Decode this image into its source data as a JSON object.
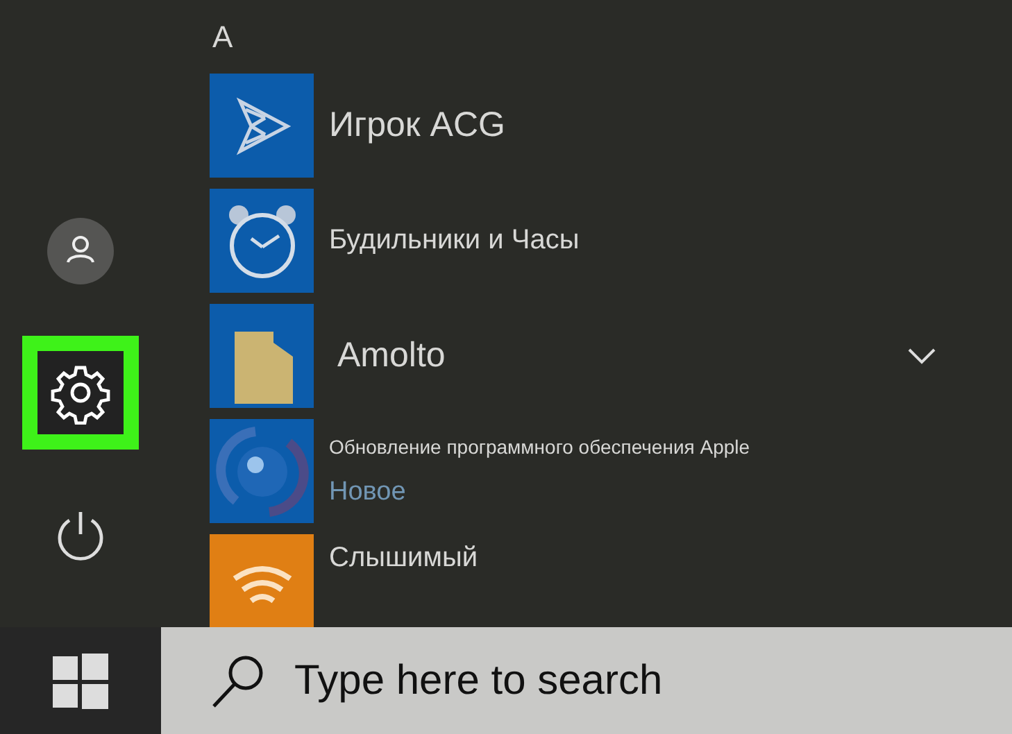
{
  "rail": [
    {
      "kind": "account",
      "highlighted": false
    },
    {
      "kind": "settings",
      "highlighted": true
    },
    {
      "kind": "power",
      "highlighted": false
    }
  ],
  "app_list": {
    "group_letter": "A",
    "apps": [
      {
        "kind": "app",
        "name": "Игрок ACG",
        "color": "#0c5cab"
      },
      {
        "kind": "app",
        "name": "Будильники и Часы",
        "color": "#0c5cab"
      },
      {
        "kind": "folder",
        "name": "Amolto",
        "color": "#0c5cab",
        "expanded": false
      },
      {
        "kind": "app_with_status",
        "name": "Обновление программного обеспечения Apple",
        "status": "Новое",
        "color": "#0c5cab"
      },
      {
        "kind": "app",
        "name": "Слышимый",
        "color": "#e07f14"
      }
    ]
  },
  "taskbar": {
    "search": {
      "placeholder": "Type here to search"
    }
  }
}
